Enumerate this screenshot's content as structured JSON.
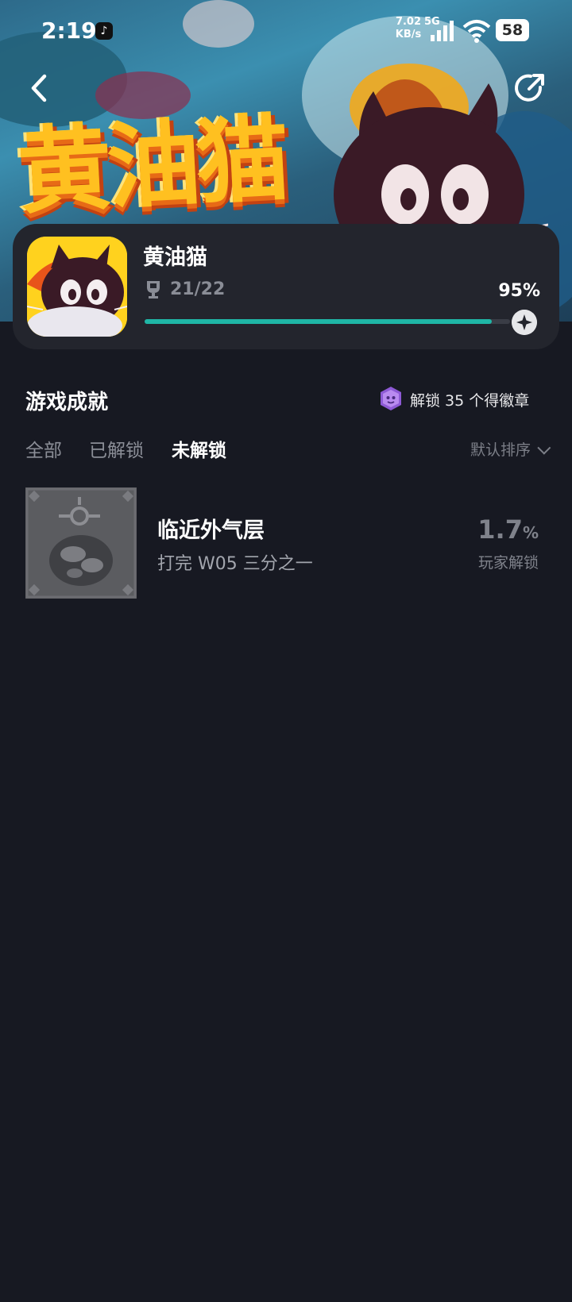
{
  "status_bar": {
    "time": "2:19",
    "net_speed_value": "7.02",
    "net_speed_unit": "KB/s",
    "net_type": "5G",
    "battery": "58"
  },
  "hero": {
    "banner_title": "黄油猫"
  },
  "game": {
    "name": "黄油猫",
    "trophy_count": "21/22",
    "percent_label": "95%",
    "progress": 0.95
  },
  "section": {
    "title": "游戏成就",
    "badge_text": "解锁 35 个得徽章"
  },
  "tabs": [
    {
      "label": "全部",
      "active": false
    },
    {
      "label": "已解锁",
      "active": false
    },
    {
      "label": "未解锁",
      "active": true
    }
  ],
  "sort": {
    "label": "默认排序"
  },
  "achievements": [
    {
      "name": "临近外气层",
      "description": "打完 W05 三分之一",
      "rate_value": "1.7",
      "rate_unit": "%",
      "rate_label": "玩家解锁"
    }
  ],
  "colors": {
    "background": "#171922",
    "card": "#23252d",
    "progress_fill": "#1fb6a6",
    "muted_text": "#8b8e97"
  }
}
